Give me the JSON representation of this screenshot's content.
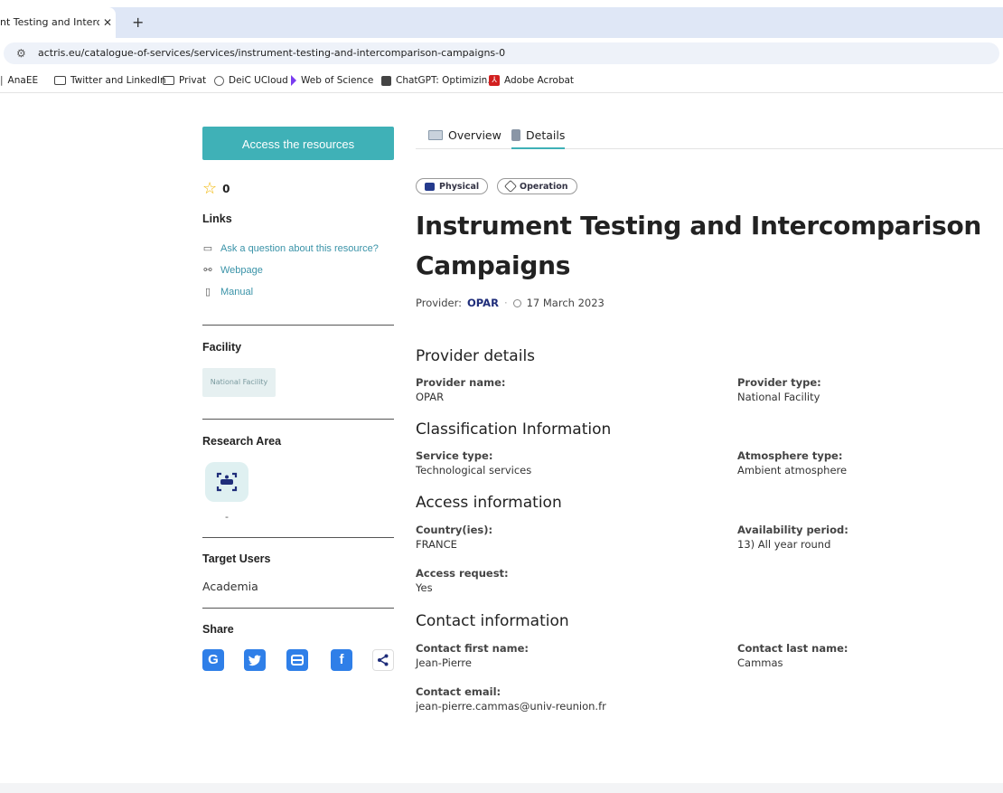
{
  "browser": {
    "tab_title": "nt Testing and Intercom",
    "tab_close": "✕",
    "new_tab": "+",
    "url": "actris.eu/catalogue-of-services/services/instrument-testing-and-intercomparison-campaigns-0",
    "bookmarks": [
      {
        "label": "AnaEE",
        "icon": "folder-icon"
      },
      {
        "label": "Twitter and LinkedIn",
        "icon": "folder-icon"
      },
      {
        "label": "Privat",
        "icon": "folder-icon"
      },
      {
        "label": "DeiC UCloud",
        "icon": "deic-icon"
      },
      {
        "label": "Web of Science",
        "icon": "wos-icon"
      },
      {
        "label": "ChatGPT: Optimizin...",
        "icon": "chatgpt-icon"
      },
      {
        "label": "Adobe Acrobat",
        "icon": "acrobat-icon"
      }
    ]
  },
  "sidebar": {
    "access_button": "Access the resources",
    "rating_count": "0",
    "links_heading": "Links",
    "links": [
      {
        "label": "Ask a question about this resource?",
        "icon": "comment-icon"
      },
      {
        "label": "Webpage",
        "icon": "link-icon"
      },
      {
        "label": "Manual",
        "icon": "manual-icon"
      }
    ],
    "facility_heading": "Facility",
    "facility_badge": "National Facility",
    "research_heading": "Research Area",
    "research_value": "-",
    "target_heading": "Target Users",
    "target_value": "Academia",
    "share_heading": "Share",
    "share_buttons": [
      {
        "label": "G",
        "icon": "google-icon",
        "color": "#2f7fe8"
      },
      {
        "label": "t",
        "icon": "twitter-icon",
        "color": "#2f7fe8"
      },
      {
        "label": "p",
        "icon": "print-icon",
        "color": "#2f7fe8"
      },
      {
        "label": "f",
        "icon": "facebook-icon",
        "color": "#2f7fe8"
      },
      {
        "label": "<",
        "icon": "share-icon",
        "color": "#ffffff"
      }
    ]
  },
  "main": {
    "tabs": [
      {
        "label": "Overview",
        "icon": "book-icon"
      },
      {
        "label": "Details",
        "icon": "document-icon"
      }
    ],
    "chips": [
      {
        "label": "Physical",
        "icon": "physical-icon"
      },
      {
        "label": "Operation",
        "icon": "tag-icon"
      }
    ],
    "title": "Instrument Testing and Intercomparison Campaigns",
    "provider_label": "Provider:",
    "provider_name": "OPAR",
    "date": "17 March 2023",
    "sections": {
      "provider": {
        "heading": "Provider details",
        "name_label": "Provider name:",
        "name_value": "OPAR",
        "type_label": "Provider type:",
        "type_value": "National Facility"
      },
      "classification": {
        "heading": "Classification Information",
        "service_label": "Service type:",
        "service_value": "Technological services",
        "atmosphere_label": "Atmosphere type:",
        "atmosphere_value": "Ambient atmosphere"
      },
      "access": {
        "heading": "Access information",
        "country_label": "Country(ies):",
        "country_value": "FRANCE",
        "availability_label": "Availability period:",
        "availability_value": "13) All year round",
        "request_label": "Access request:",
        "request_value": "Yes"
      },
      "contact": {
        "heading": "Contact information",
        "first_label": "Contact first name:",
        "first_value": "Jean-Pierre",
        "last_label": "Contact last name:",
        "last_value": "Cammas",
        "email_label": "Contact email:",
        "email_value": "jean-pierre.cammas@univ-reunion.fr"
      }
    }
  }
}
